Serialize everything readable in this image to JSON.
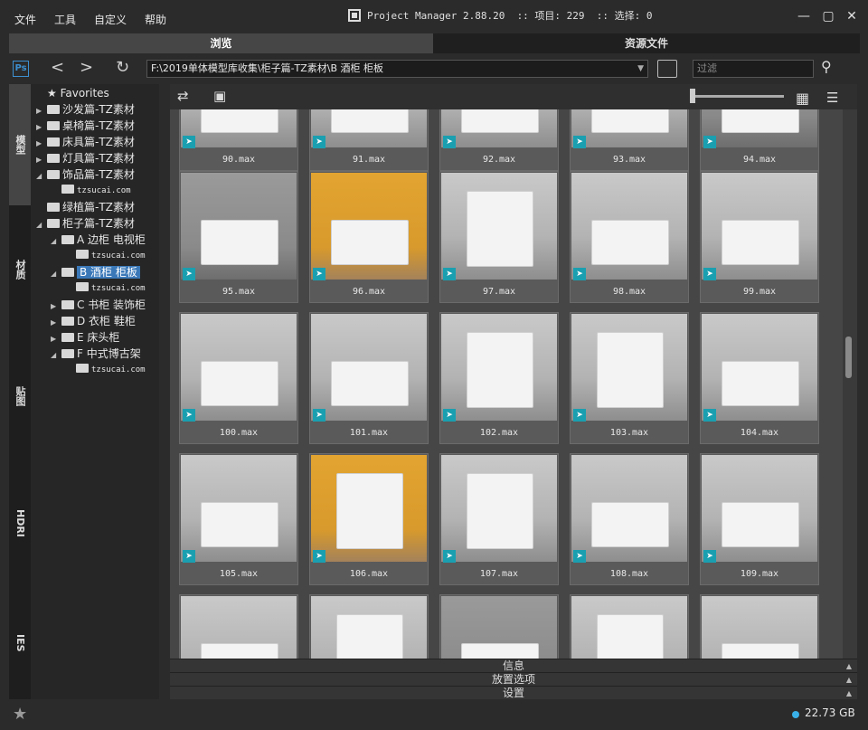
{
  "menu": [
    "文件",
    "工具",
    "自定义",
    "帮助"
  ],
  "window": {
    "title": "Project Manager 2.88.20  :: 项目: 229  :: 选择: 0",
    "minimize": "—",
    "maximize": "▢",
    "close": "✕"
  },
  "tabs": {
    "browse": "浏览",
    "assets": "资源文件"
  },
  "toolbar": {
    "ps_label": "Ps",
    "back": "<",
    "forward": ">",
    "refresh": "↻",
    "path": "F:\\2019单体模型库收集\\柜子篇-TZ素材\\B 酒柜 柜板",
    "filter_placeholder": "过滤",
    "search_icon": "⚲",
    "path_dropdown": "▼"
  },
  "side_tabs": [
    "模型",
    "材质",
    "贴图",
    "HDRI",
    "IES"
  ],
  "tree": [
    {
      "label": "Favorites",
      "icon": "star-icon",
      "indent": 0,
      "arrow": ""
    },
    {
      "label": "沙发篇-TZ素材",
      "indent": 0,
      "arrow": "▶"
    },
    {
      "label": "桌椅篇-TZ素材",
      "indent": 0,
      "arrow": "▶"
    },
    {
      "label": "床具篇-TZ素材",
      "indent": 0,
      "arrow": "▶"
    },
    {
      "label": "灯具篇-TZ素材",
      "indent": 0,
      "arrow": "▶"
    },
    {
      "label": "饰品篇-TZ素材",
      "indent": 0,
      "arrow": "◢"
    },
    {
      "label": "tzsucai.com",
      "indent": 1,
      "arrow": "",
      "small": true
    },
    {
      "label": "绿植篇-TZ素材",
      "indent": 0,
      "arrow": ""
    },
    {
      "label": "柜子篇-TZ素材",
      "indent": 0,
      "arrow": "◢"
    },
    {
      "label": "A 边柜 电视柜",
      "indent": 1,
      "arrow": "◢"
    },
    {
      "label": "tzsucai.com",
      "indent": 2,
      "arrow": "",
      "small": true
    },
    {
      "label": "B 酒柜 柜板",
      "indent": 1,
      "arrow": "◢",
      "selected": true
    },
    {
      "label": "tzsucai.com",
      "indent": 2,
      "arrow": "",
      "small": true
    },
    {
      "label": "C 书柜 装饰柜",
      "indent": 1,
      "arrow": "▶"
    },
    {
      "label": "D 衣柜 鞋柜",
      "indent": 1,
      "arrow": "▶"
    },
    {
      "label": "E 床头柜",
      "indent": 1,
      "arrow": "▶"
    },
    {
      "label": "F 中式博古架",
      "indent": 1,
      "arrow": "◢"
    },
    {
      "label": "tzsucai.com",
      "indent": 2,
      "arrow": "",
      "small": true
    }
  ],
  "files": [
    {
      "name": "90.max",
      "style": "light"
    },
    {
      "name": "91.max",
      "style": "light"
    },
    {
      "name": "92.max",
      "style": "light"
    },
    {
      "name": "93.max",
      "style": "light"
    },
    {
      "name": "94.max",
      "style": "dark"
    },
    {
      "name": "95.max",
      "style": "dark"
    },
    {
      "name": "96.max",
      "style": "yellow"
    },
    {
      "name": "97.max",
      "style": "tall"
    },
    {
      "name": "98.max",
      "style": "light"
    },
    {
      "name": "99.max",
      "style": "light"
    },
    {
      "name": "100.max",
      "style": "light"
    },
    {
      "name": "101.max",
      "style": "light"
    },
    {
      "name": "102.max",
      "style": "tall"
    },
    {
      "name": "103.max",
      "style": "tall"
    },
    {
      "name": "104.max",
      "style": "light"
    },
    {
      "name": "105.max",
      "style": "light"
    },
    {
      "name": "106.max",
      "style": "yellowtall"
    },
    {
      "name": "107.max",
      "style": "tall"
    },
    {
      "name": "108.max",
      "style": "light"
    },
    {
      "name": "109.max",
      "style": "light"
    },
    {
      "name": "",
      "style": "light"
    },
    {
      "name": "",
      "style": "tall"
    },
    {
      "name": "",
      "style": "dark"
    },
    {
      "name": "",
      "style": "tall"
    },
    {
      "name": "",
      "style": "light"
    }
  ],
  "panels": [
    "信息",
    "放置选项",
    "设置"
  ],
  "status": {
    "disk": "22.73 GB"
  },
  "colors": {
    "accent": "#3a78b8",
    "max_icon": "#1a9fb0",
    "disk_dot": "#3ab0e8"
  }
}
